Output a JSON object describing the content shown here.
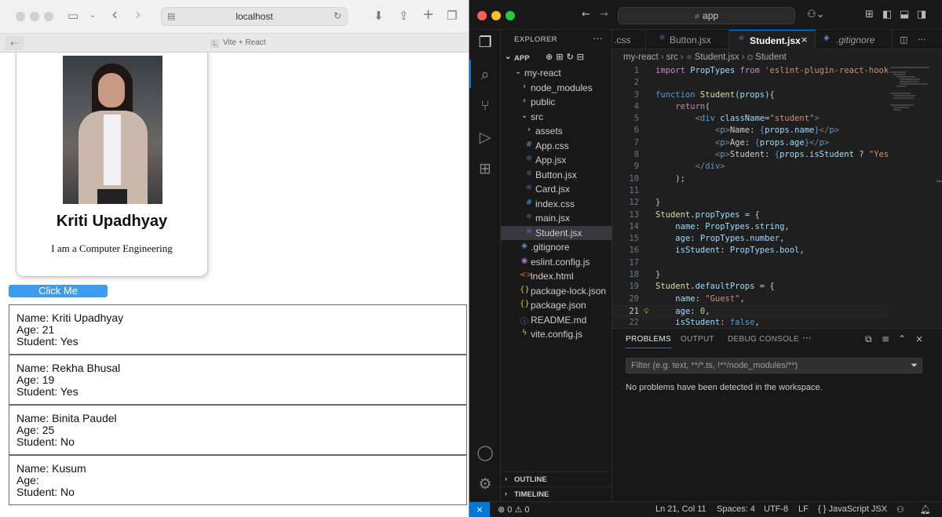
{
  "browser": {
    "address": "localhost",
    "tab_title": "Vite + React",
    "tab_fav": "L",
    "icons": {
      "sidebar": "▭",
      "back": "‹",
      "forward": "›",
      "download": "⬇",
      "share": "⇪",
      "new_tab": "+",
      "tabs": "❐",
      "reload": "↻",
      "site": "▤",
      "page_back": "⇠"
    }
  },
  "card": {
    "name": "Kriti Upadhyay",
    "description": "I am a Computer Engineering"
  },
  "button": {
    "label": "Click Me"
  },
  "students": [
    {
      "name": "Name: Kriti Upadhyay",
      "age": "Age: 21",
      "student": "Student: Yes"
    },
    {
      "name": "Name: Rekha Bhusal",
      "age": "Age: 19",
      "student": "Student: Yes"
    },
    {
      "name": "Name: Binita Paudel",
      "age": "Age: 25",
      "student": "Student: No"
    },
    {
      "name": "Name: Kusum",
      "age": "Age:",
      "student": "Student: No"
    }
  ],
  "vscode": {
    "search": "app",
    "explorer_title": "EXPLORER",
    "root": "APP",
    "tree": [
      {
        "label": "my-react",
        "icon": "⌄",
        "indent": 16,
        "color": "#cccccc"
      },
      {
        "label": "node_modules",
        "icon": "›",
        "indent": 24,
        "color": "#cccccc"
      },
      {
        "label": "public",
        "icon": "›",
        "indent": 24,
        "color": "#cccccc"
      },
      {
        "label": "src",
        "icon": "⌄",
        "indent": 24,
        "color": "#cccccc"
      },
      {
        "label": "assets",
        "icon": "›",
        "indent": 30,
        "color": "#cccccc"
      },
      {
        "label": "App.css",
        "icon": "#",
        "indent": 30,
        "color": "#519aba"
      },
      {
        "label": "App.jsx",
        "icon": "⚛",
        "indent": 30,
        "color": "#6d8fc4"
      },
      {
        "label": "Button.jsx",
        "icon": "⚛",
        "indent": 30,
        "color": "#6d8fc4"
      },
      {
        "label": "Card.jsx",
        "icon": "⚛",
        "indent": 30,
        "color": "#6d8fc4"
      },
      {
        "label": "index.css",
        "icon": "#",
        "indent": 30,
        "color": "#519aba"
      },
      {
        "label": "main.jsx",
        "icon": "⚛",
        "indent": 30,
        "color": "#6d8fc4"
      },
      {
        "label": "Student.jsx",
        "icon": "⚛",
        "indent": 30,
        "color": "#6d8fc4",
        "selected": true
      },
      {
        "label": ".gitignore",
        "icon": "◈",
        "indent": 24,
        "color": "#6d8fc4"
      },
      {
        "label": "eslint.config.js",
        "icon": "◉",
        "indent": 24,
        "color": "#a074c4"
      },
      {
        "label": "index.html",
        "icon": "<>",
        "indent": 24,
        "color": "#e37933"
      },
      {
        "label": "package-lock.json",
        "icon": "{}",
        "indent": 24,
        "color": "#cbcb41"
      },
      {
        "label": "package.json",
        "icon": "{}",
        "indent": 24,
        "color": "#cbcb41"
      },
      {
        "label": "README.md",
        "icon": "ⓘ",
        "indent": 24,
        "color": "#519aba"
      },
      {
        "label": "vite.config.js",
        "icon": "ϟ",
        "indent": 24,
        "color": "#cbcb41"
      }
    ],
    "outline": "OUTLINE",
    "timeline": "TIMELINE",
    "tabs": [
      {
        "label": ".css",
        "active": false
      },
      {
        "label": "Button.jsx",
        "active": false
      },
      {
        "label": "Student.jsx",
        "active": true
      },
      {
        "label": ".gitignore",
        "active": false
      }
    ],
    "breadcrumb": [
      "my-react",
      "src",
      "Student.jsx",
      "Student"
    ],
    "code": [
      {
        "n": "1",
        "html": "<span class='kw2'>import</span> <span class='prop'>PropTypes</span> <span class='kw2'>from</span> <span class='str'>'eslint-plugin-react-hooks'</span>"
      },
      {
        "n": "2",
        "html": ""
      },
      {
        "n": "3",
        "html": "<span class='kw'>function</span> <span class='fn'>Student</span>(<span class='prop'>props</span>){"
      },
      {
        "n": "4",
        "html": "    <span class='kw2'>return</span>("
      },
      {
        "n": "5",
        "html": "        <span class='punc'>&lt;</span><span class='tag'>div</span> <span class='attr'>className</span>=<span class='str'>\"student\"</span><span class='punc'>&gt;</span>"
      },
      {
        "n": "6",
        "html": "            <span class='punc'>&lt;</span><span class='tag'>p</span><span class='punc'>&gt;</span>Name: <span class='kw'>{</span><span class='prop'>props</span>.<span class='prop'>name</span><span class='kw'>}</span><span class='punc'>&lt;/</span><span class='tag'>p</span><span class='punc'>&gt;</span>"
      },
      {
        "n": "7",
        "html": "            <span class='punc'>&lt;</span><span class='tag'>p</span><span class='punc'>&gt;</span>Age: <span class='kw'>{</span><span class='prop'>props</span>.<span class='prop'>age</span><span class='kw'>}</span><span class='punc'>&lt;/</span><span class='tag'>p</span><span class='punc'>&gt;</span>"
      },
      {
        "n": "8",
        "html": "            <span class='punc'>&lt;</span><span class='tag'>p</span><span class='punc'>&gt;</span>Student: <span class='kw'>{</span><span class='prop'>props</span>.<span class='prop'>isStudent</span> ? <span class='str'>\"Yes\"</span>"
      },
      {
        "n": "9",
        "html": "        <span class='punc'>&lt;/</span><span class='tag'>div</span><span class='punc'>&gt;</span>"
      },
      {
        "n": "10",
        "html": "    );"
      },
      {
        "n": "11",
        "html": ""
      },
      {
        "n": "12",
        "html": "}"
      },
      {
        "n": "13",
        "html": "<span class='fn'>Student</span>.<span class='prop'>propTypes</span> = {"
      },
      {
        "n": "14",
        "html": "    <span class='prop'>name</span>: <span class='prop'>PropTypes</span>.<span class='prop'>string</span>,"
      },
      {
        "n": "15",
        "html": "    <span class='prop'>age</span>: <span class='prop'>PropTypes</span>.<span class='prop'>number</span>,"
      },
      {
        "n": "16",
        "html": "    <span class='prop'>isStudent</span>: <span class='prop'>PropTypes</span>.<span class='prop'>bool</span>,"
      },
      {
        "n": "17",
        "html": ""
      },
      {
        "n": "18",
        "html": "}"
      },
      {
        "n": "19",
        "html": "<span class='fn'>Student</span>.<span class='prop'>defaultProps</span> = {"
      },
      {
        "n": "20",
        "html": "    <span class='prop'>name</span>: <span class='str'>\"Guest\"</span>,"
      },
      {
        "n": "21",
        "html": "    <span class='prop'>age</span>: <span class='num'>0</span>,",
        "current": true
      },
      {
        "n": "22",
        "html": "    <span class='prop'>isStudent</span>: <span class='kw'>false</span>,"
      }
    ],
    "panel": {
      "tabs": [
        "PROBLEMS",
        "OUTPUT",
        "DEBUG CONSOLE"
      ],
      "filter_placeholder": "Filter (e.g. text, **/*.ts, !**/node_modules/**)",
      "message": "No problems have been detected in the workspace."
    },
    "status": {
      "problems": "⊗ 0 ⚠ 0",
      "position": "Ln 21, Col 11",
      "spaces": "Spaces: 4",
      "encoding": "UTF-8",
      "eol": "LF",
      "language": "{ } JavaScript JSX"
    },
    "colors": {
      "accent": "#0078d4",
      "button": "#3b9cf0"
    }
  }
}
